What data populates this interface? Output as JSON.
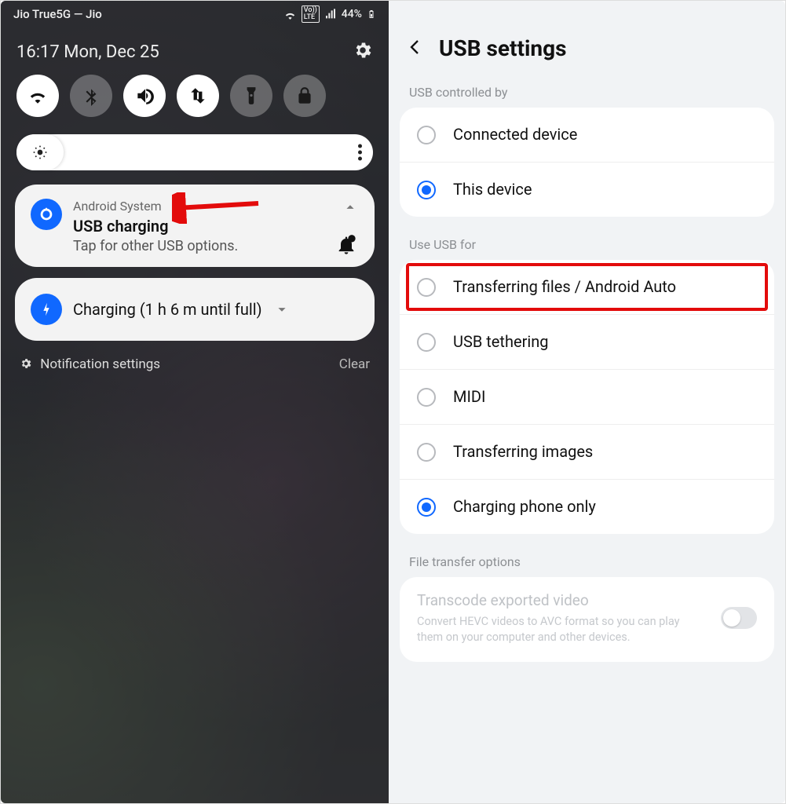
{
  "left": {
    "status_carrier": "Jio True5G — Jio",
    "status_battery": "44%",
    "qs_time": "16:17  Mon, Dec 25",
    "notif_usb": {
      "source": "Android System",
      "title": "USB charging",
      "subtitle": "Tap for other USB options."
    },
    "notif_charge": "Charging (1 h 6 m until full)",
    "settings_link": "Notification settings",
    "clear_link": "Clear"
  },
  "right": {
    "title": "USB settings",
    "section1": "USB controlled by",
    "controlled_opts": [
      {
        "label": "Connected device",
        "selected": false
      },
      {
        "label": "This device",
        "selected": true
      }
    ],
    "section2": "Use USB for",
    "use_opts": [
      {
        "label": "Transferring files / Android Auto",
        "selected": false,
        "highlight": true
      },
      {
        "label": "USB tethering",
        "selected": false
      },
      {
        "label": "MIDI",
        "selected": false
      },
      {
        "label": "Transferring images",
        "selected": false
      },
      {
        "label": "Charging phone only",
        "selected": true
      }
    ],
    "section3": "File transfer options",
    "transcode_title": "Transcode exported video",
    "transcode_desc": "Convert HEVC videos to AVC format so you can play them on your computer and other devices."
  }
}
